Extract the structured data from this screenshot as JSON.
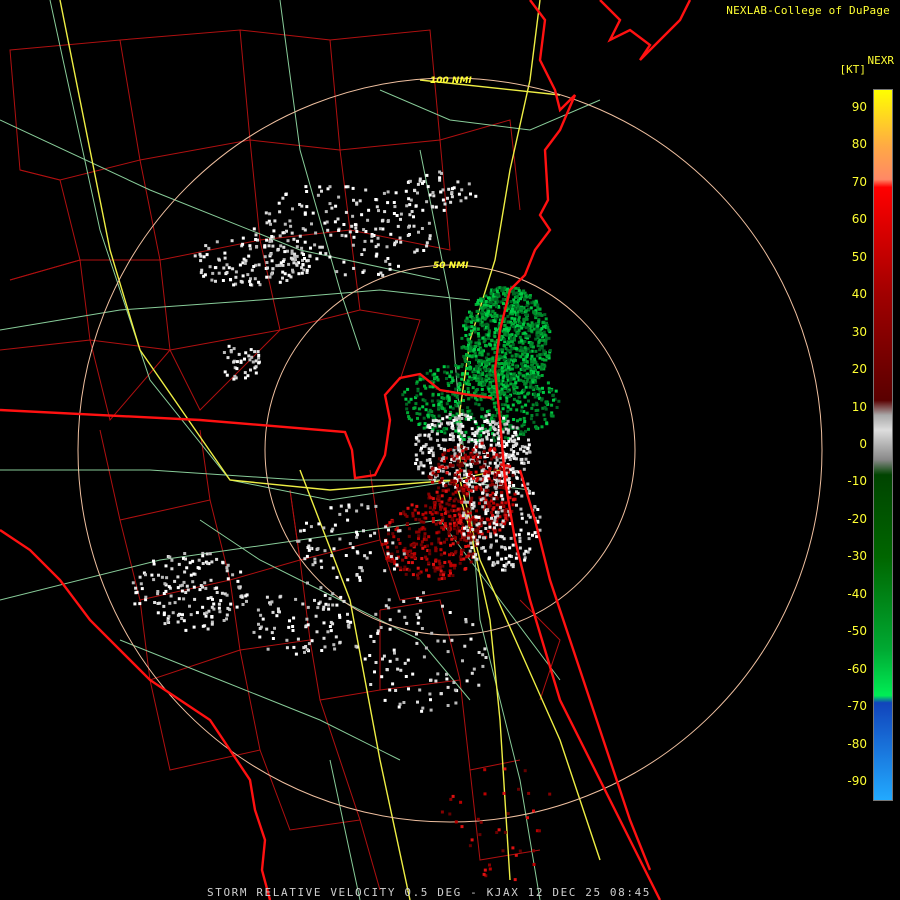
{
  "credit": "NEXLAB-College of DuPage",
  "product": "NEXR",
  "units": "[KT]",
  "footer": "STORM RELATIVE VELOCITY 0.5 DEG - KJAX 12 DEC 25 08:45",
  "range_rings": [
    "100 NMI",
    "50 NMI"
  ],
  "colorbar": {
    "ticks": [
      "90",
      "80",
      "70",
      "60",
      "50",
      "40",
      "30",
      "20",
      "10",
      "0",
      "-10",
      "-20",
      "-30",
      "-40",
      "-50",
      "-60",
      "-70",
      "-80",
      "-90"
    ],
    "stops": [
      {
        "v": 95,
        "c": "#ffff00"
      },
      {
        "v": 80,
        "c": "#ffaa44"
      },
      {
        "v": 71,
        "c": "#ff8866"
      },
      {
        "v": 69,
        "c": "#ff0000"
      },
      {
        "v": 40,
        "c": "#a00000"
      },
      {
        "v": 12,
        "c": "#5a0000"
      },
      {
        "v": 8,
        "c": "#aaaaaa"
      },
      {
        "v": 4,
        "c": "#dddddd"
      },
      {
        "v": -4,
        "c": "#888888"
      },
      {
        "v": -8,
        "c": "#004400"
      },
      {
        "v": -30,
        "c": "#006600"
      },
      {
        "v": -55,
        "c": "#00aa33"
      },
      {
        "v": -67,
        "c": "#00ee55"
      },
      {
        "v": -69,
        "c": "#1144bb"
      },
      {
        "v": -95,
        "c": "#22aaff"
      }
    ]
  },
  "colors": {
    "coast": "#ff1111",
    "counties": "#b01010",
    "highways": "#eeee44",
    "roads": "#88cc99",
    "rings": "#f0c0a0",
    "ring_labels": "#ffff33"
  }
}
